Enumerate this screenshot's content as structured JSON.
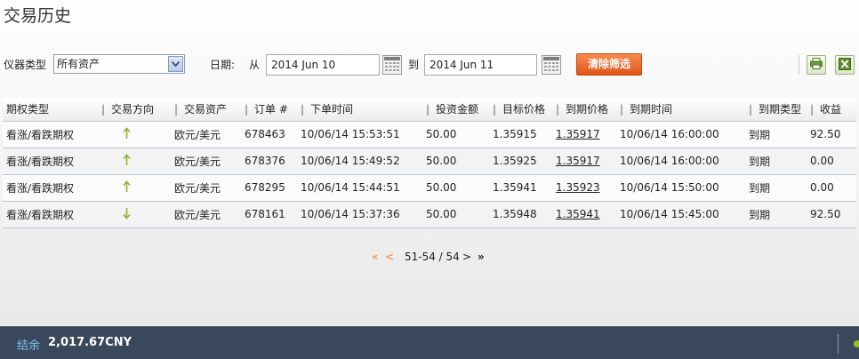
{
  "page": {
    "title": "交易历史"
  },
  "filters": {
    "asset_type_label": "仪器类型",
    "asset_type_value": "所有资产",
    "date_label": "日期:",
    "from_label": "从",
    "from_date": "2014 Jun 10",
    "to_label": "到",
    "to_date": "2014 Jun 11",
    "clear_button": "清除筛选",
    "print_icon": "printer-icon",
    "export_icon": "excel-icon"
  },
  "table": {
    "headers": [
      "期权类型",
      "交易方向",
      "交易资产",
      "订单 #",
      "下单时间",
      "投资金额",
      "目标价格",
      "到期价格",
      "到期时间",
      "到期类型",
      "收益"
    ],
    "rows": [
      {
        "option_type": "看涨/看跌期权",
        "direction": "up",
        "direction_symbol": "↑",
        "asset": "欧元/美元",
        "order": "678463",
        "order_time": "10/06/14 15:53:51",
        "amount": "50.00",
        "target_price": "1.35915",
        "expiry_price": "1.35917",
        "expiry_time": "10/06/14 16:00:00",
        "expiry_type": "到期",
        "profit": "92.50"
      },
      {
        "option_type": "看涨/看跌期权",
        "direction": "up",
        "direction_symbol": "↑",
        "asset": "欧元/美元",
        "order": "678376",
        "order_time": "10/06/14 15:49:52",
        "amount": "50.00",
        "target_price": "1.35925",
        "expiry_price": "1.35917",
        "expiry_time": "10/06/14 16:00:00",
        "expiry_type": "到期",
        "profit": "0.00"
      },
      {
        "option_type": "看涨/看跌期权",
        "direction": "up",
        "direction_symbol": "↑",
        "asset": "欧元/美元",
        "order": "678295",
        "order_time": "10/06/14 15:44:51",
        "amount": "50.00",
        "target_price": "1.35941",
        "expiry_price": "1.35923",
        "expiry_time": "10/06/14 15:50:00",
        "expiry_type": "到期",
        "profit": "0.00"
      },
      {
        "option_type": "看涨/看跌期权",
        "direction": "down",
        "direction_symbol": "↓",
        "asset": "欧元/美元",
        "order": "678161",
        "order_time": "10/06/14 15:37:36",
        "amount": "50.00",
        "target_price": "1.35948",
        "expiry_price": "1.35941",
        "expiry_time": "10/06/14 15:45:00",
        "expiry_type": "到期",
        "profit": "92.50"
      }
    ]
  },
  "pager": {
    "first": "«",
    "prev": "<",
    "range": "51-54 / 54",
    "next": ">",
    "last": "»"
  },
  "footer": {
    "balance_label": "结余",
    "balance_value": "2,017.67CNY"
  },
  "colors": {
    "accent_orange": "#ec6a2c",
    "arrow_green": "#8fb42a",
    "footer_bg": "#39485a"
  }
}
